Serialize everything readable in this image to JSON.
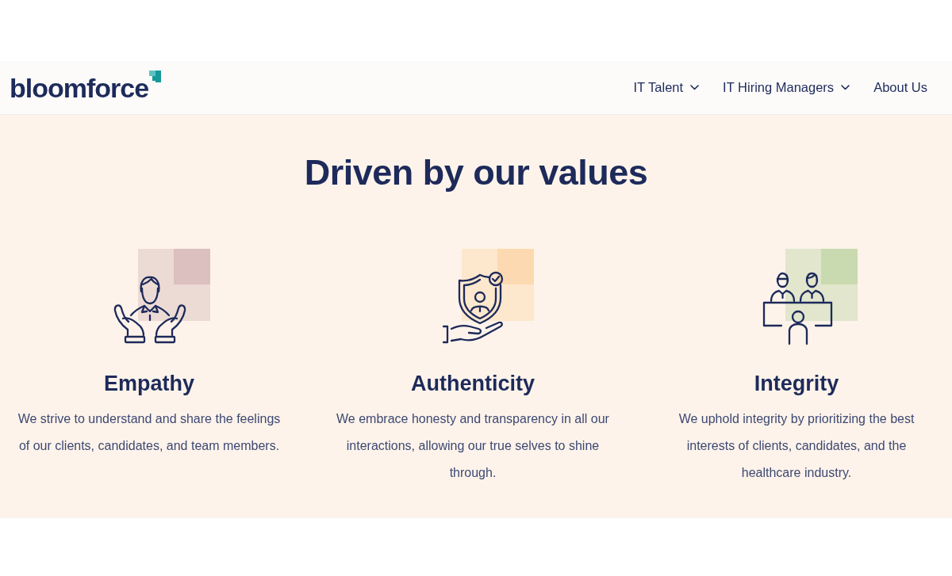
{
  "header": {
    "logo": "bloomforce",
    "nav": [
      {
        "label": "IT Talent",
        "dropdown": true
      },
      {
        "label": "IT Hiring Managers",
        "dropdown": true
      },
      {
        "label": "About Us",
        "dropdown": false
      }
    ]
  },
  "section": {
    "title": "Driven by our values",
    "values": [
      {
        "kind": "hands",
        "title": "Empathy",
        "text": "We strive to understand and share the feelings of our clients, candidates, and team members."
      },
      {
        "kind": "shield",
        "title": "Authenticity",
        "text": "We embrace honesty and transparency in all our interactions, allowing our true selves to shine through."
      },
      {
        "kind": "meeting",
        "title": "Integrity",
        "text": "We uphold integrity by prioritizing the best interests of clients, candidates, and the healthcare industry."
      }
    ]
  }
}
